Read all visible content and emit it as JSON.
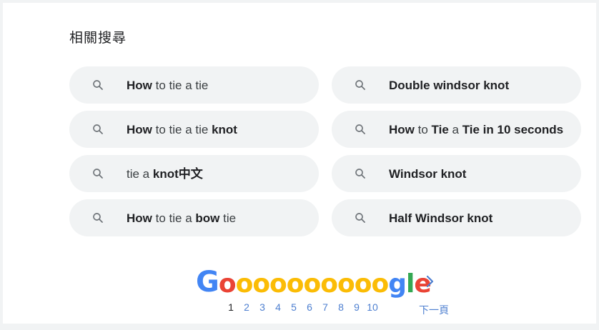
{
  "section_title": "相關搜尋",
  "colors": {
    "chip_bg": "#f1f3f4",
    "text_primary": "#202124",
    "link_blue": "#4d7fd0",
    "google_blue": "#4285f4",
    "google_red": "#ea4335",
    "google_yellow": "#fbbc05",
    "google_green": "#34a853"
  },
  "related_searches": [
    {
      "segments": [
        {
          "text": "How",
          "bold": true
        },
        {
          "text": " to tie a tie",
          "bold": false
        }
      ],
      "icon": "search-icon"
    },
    {
      "segments": [
        {
          "text": "Double windsor knot",
          "bold": true
        }
      ],
      "icon": "search-icon"
    },
    {
      "segments": [
        {
          "text": "How",
          "bold": true
        },
        {
          "text": " to tie a tie ",
          "bold": false
        },
        {
          "text": "knot",
          "bold": true
        }
      ],
      "icon": "search-icon"
    },
    {
      "segments": [
        {
          "text": "How",
          "bold": true
        },
        {
          "text": " to ",
          "bold": false
        },
        {
          "text": "Tie",
          "bold": true
        },
        {
          "text": " a ",
          "bold": false
        },
        {
          "text": "Tie in 10 seconds",
          "bold": true
        }
      ],
      "icon": "search-icon"
    },
    {
      "segments": [
        {
          "text": "tie a ",
          "bold": false
        },
        {
          "text": "knot中文",
          "bold": true
        }
      ],
      "icon": "search-icon"
    },
    {
      "segments": [
        {
          "text": "Windsor knot",
          "bold": true
        }
      ],
      "icon": "search-icon"
    },
    {
      "segments": [
        {
          "text": "How",
          "bold": true
        },
        {
          "text": " to tie a ",
          "bold": false
        },
        {
          "text": "bow",
          "bold": true
        },
        {
          "text": " tie",
          "bold": false
        }
      ],
      "icon": "search-icon"
    },
    {
      "segments": [
        {
          "text": "Half Windsor knot",
          "bold": true
        }
      ],
      "icon": "search-icon"
    }
  ],
  "pagination": {
    "logo_letters": [
      {
        "ch": "G",
        "color": "#4285f4"
      },
      {
        "ch": "o",
        "color": "#ea4335"
      },
      {
        "ch": "o",
        "color": "#fbbc05"
      },
      {
        "ch": "o",
        "color": "#fbbc05"
      },
      {
        "ch": "o",
        "color": "#fbbc05"
      },
      {
        "ch": "o",
        "color": "#fbbc05"
      },
      {
        "ch": "o",
        "color": "#fbbc05"
      },
      {
        "ch": "o",
        "color": "#fbbc05"
      },
      {
        "ch": "o",
        "color": "#fbbc05"
      },
      {
        "ch": "o",
        "color": "#fbbc05"
      },
      {
        "ch": "o",
        "color": "#fbbc05"
      },
      {
        "ch": "g",
        "color": "#4285f4"
      },
      {
        "ch": "l",
        "color": "#34a853"
      },
      {
        "ch": "e",
        "color": "#ea4335"
      }
    ],
    "pages": [
      "1",
      "2",
      "3",
      "4",
      "5",
      "6",
      "7",
      "8",
      "9",
      "10"
    ],
    "current_page": "1",
    "next_label": "下一頁",
    "next_icon": "chevron-right-icon"
  }
}
